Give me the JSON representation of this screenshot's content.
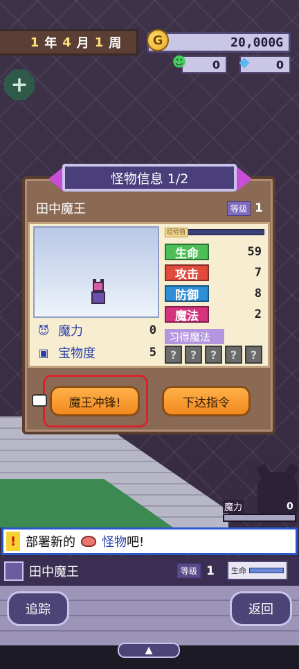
{
  "header": {
    "year": "1",
    "year_unit": "年",
    "month": "4",
    "month_unit": "月",
    "week": "1",
    "week_unit": "周",
    "gold": "20,000G",
    "resource_a": "0",
    "resource_b": "0"
  },
  "panel": {
    "title": "怪物信息 1/2",
    "monster_name": "田中魔王",
    "level_label": "等级",
    "level": "1",
    "exp_label": "经验值",
    "mana_label": "魔力",
    "mana_value": "0",
    "treasure_label": "宝物度",
    "treasure_value": "5",
    "stats": [
      {
        "label": "生命",
        "value": "59",
        "color": "#4bbf55"
      },
      {
        "label": "攻击",
        "value": "7",
        "color": "#e24a3b"
      },
      {
        "label": "防御",
        "value": "8",
        "color": "#2f8fd6"
      },
      {
        "label": "魔法",
        "value": "2",
        "color": "#d6337f"
      }
    ],
    "learned_magic_label": "习得魔法",
    "magic_slots": [
      "?",
      "?",
      "?",
      "?",
      "?"
    ],
    "charge_button": "魔王冲锋!",
    "order_button": "下达指令"
  },
  "scene": {
    "mana_label": "魔力",
    "mana_value": "0"
  },
  "notice": {
    "prefix": "部署新的",
    "highlight": "怪物",
    "suffix": "吧!",
    "icon": "exclamation-icon"
  },
  "info_bar": {
    "name": "田中魔王",
    "level_label": "等级",
    "level": "1",
    "hp_label": "生命"
  },
  "nav": {
    "track": "追踪",
    "back": "返回"
  }
}
